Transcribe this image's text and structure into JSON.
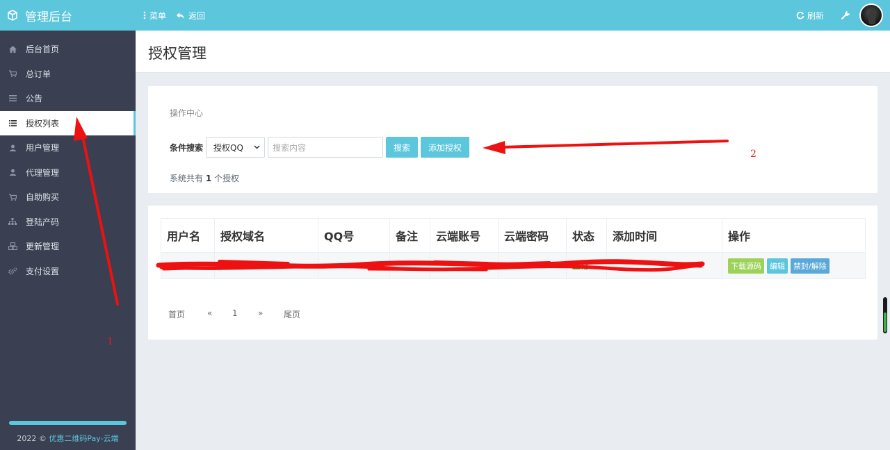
{
  "header": {
    "brand": "管理后台",
    "menu_label": "菜单",
    "back_label": "返回",
    "refresh_label": "刷新"
  },
  "sidebar": {
    "items": [
      {
        "label": "后台首页",
        "icon": "home-icon"
      },
      {
        "label": "总订单",
        "icon": "cart-icon"
      },
      {
        "label": "公告",
        "icon": "list-icon"
      },
      {
        "label": "授权列表",
        "icon": "list-icon",
        "active": true
      },
      {
        "label": "用户管理",
        "icon": "user-icon"
      },
      {
        "label": "代理管理",
        "icon": "user-icon"
      },
      {
        "label": "自助购买",
        "icon": "cart-icon"
      },
      {
        "label": "登陆产码",
        "icon": "sitemap-icon"
      },
      {
        "label": "更新管理",
        "icon": "cubes-icon"
      },
      {
        "label": "支付设置",
        "icon": "gears-icon"
      }
    ],
    "footer_prefix": "2022 ©",
    "footer_link": "优惠二维码Pay-云端"
  },
  "page": {
    "title": "授权管理"
  },
  "ops": {
    "title": "操作中心",
    "search_label": "条件搜索",
    "select_value": "授权QQ",
    "search_placeholder": "搜索内容",
    "search_button": "搜索",
    "add_button": "添加授权",
    "count_prefix": "系统共有",
    "count_value": "1",
    "count_suffix": "个授权"
  },
  "table": {
    "headers": [
      "用户名",
      "授权域名",
      "QQ号",
      "备注",
      "云端账号",
      "云端密码",
      "状态",
      "添加时间",
      "操作"
    ],
    "row": {
      "status": "正常",
      "actions": [
        "下载源码",
        "编辑",
        "禁封/解除"
      ]
    }
  },
  "pager": [
    "首页",
    "«",
    "1",
    "»",
    "尾页"
  ],
  "annotations": {
    "label1": "1",
    "label2": "2",
    "color": "#e02020"
  }
}
